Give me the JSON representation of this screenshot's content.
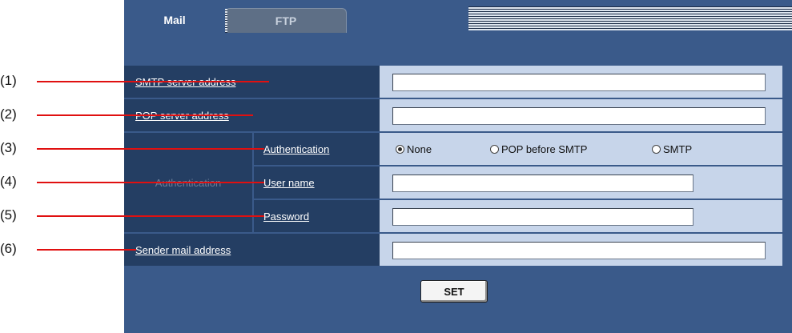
{
  "tabs": [
    {
      "label": "Mail",
      "active": true
    },
    {
      "label": "FTP",
      "active": false
    }
  ],
  "form": {
    "smtp_label": "SMTP server address",
    "smtp_value": "",
    "pop_label": "POP server address",
    "pop_value": "",
    "auth_group_label": "Authentication",
    "auth_label": "Authentication",
    "auth_options": [
      {
        "label": "None",
        "selected": true
      },
      {
        "label": "POP before SMTP",
        "selected": false
      },
      {
        "label": "SMTP",
        "selected": false
      }
    ],
    "username_label": "User name",
    "username_value": "",
    "password_label": "Password",
    "password_value": "",
    "sender_label": "Sender mail address",
    "sender_value": ""
  },
  "set_label": "SET",
  "callouts": [
    "(1)",
    "(2)",
    "(3)",
    "(4)",
    "(5)",
    "(6)"
  ],
  "colors": {
    "panel_bg": "#3a5a8a",
    "label_bg": "#243e63",
    "value_bg": "#c7d5ea",
    "callout_line": "#e01010"
  }
}
